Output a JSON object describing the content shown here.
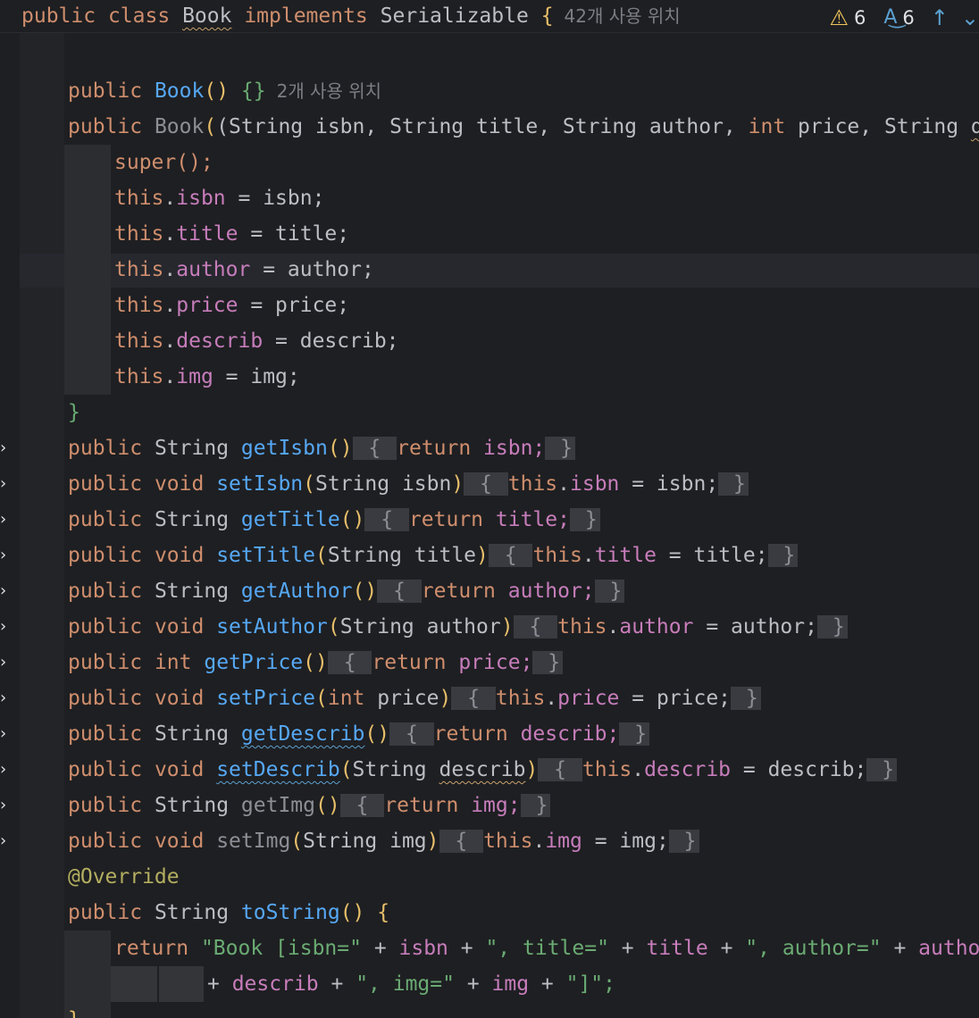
{
  "header": {
    "class_decl": [
      "public",
      "class",
      "Book",
      "implements",
      "Serializable",
      "{"
    ],
    "usage_hint": "42개 사용 위치"
  },
  "status": {
    "warnings": "6",
    "typos": "6"
  },
  "code": {
    "ctor_empty": {
      "kw": "public",
      "name": "Book",
      "parens": "()",
      "body": "{}",
      "hint": "2개 사용 위치"
    },
    "ctor_full": {
      "kw": "public",
      "name": "Book",
      "params": "(String isbn, String title, String author, ",
      "int": "int",
      "params2": " price, String ",
      "last": "describ"
    },
    "super_call": "super();",
    "assignments": [
      {
        "field": "isbn",
        "value": "isbn;"
      },
      {
        "field": "title",
        "value": "title;"
      },
      {
        "field": "author",
        "value": "author;"
      },
      {
        "field": "price",
        "value": "price;"
      },
      {
        "field": "describ",
        "value": "describ;"
      },
      {
        "field": "img",
        "value": "img;"
      }
    ],
    "this_kw": "this",
    "eq": " = ",
    "close_brace": "}",
    "accessors": [
      {
        "type": "String",
        "name": "getIsbn",
        "params": "()",
        "body_kw": "return",
        "body": " isbn;",
        "dim": false
      },
      {
        "type": "void",
        "name": "setIsbn",
        "params": "(String isbn)",
        "body_kw": "this",
        "body_field": "isbn",
        "body": " = isbn;",
        "dim": false
      },
      {
        "type": "String",
        "name": "getTitle",
        "params": "()",
        "body_kw": "return",
        "body": " title;",
        "dim": false
      },
      {
        "type": "void",
        "name": "setTitle",
        "params": "(String title)",
        "body_kw": "this",
        "body_field": "title",
        "body": " = title;",
        "dim": false
      },
      {
        "type": "String",
        "name": "getAuthor",
        "params": "()",
        "body_kw": "return",
        "body": " author;",
        "dim": false
      },
      {
        "type": "void",
        "name": "setAuthor",
        "params": "(String author)",
        "body_kw": "this",
        "body_field": "author",
        "body": " = author;",
        "dim": false
      },
      {
        "type": "int",
        "name": "getPrice",
        "params": "()",
        "body_kw": "return",
        "body": " price;",
        "dim": false
      },
      {
        "type": "void",
        "name": "setPrice",
        "params": "(int price)",
        "body_kw": "this",
        "body_field": "price",
        "body": " = price;",
        "dim": false
      },
      {
        "type": "String",
        "name": "getDescrib",
        "params": "()",
        "body_kw": "return",
        "body": " describ;",
        "dim": false
      },
      {
        "type": "void",
        "name": "setDescrib",
        "params": "(String describ)",
        "body_kw": "this",
        "body_field": "describ",
        "body": " = describ;",
        "dim": false
      },
      {
        "type": "String",
        "name": "getImg",
        "params": "()",
        "body_kw": "return",
        "body": " img;",
        "dim": true
      },
      {
        "type": "void",
        "name": "setImg",
        "params": "(String img)",
        "body_kw": "this",
        "body_field": "img",
        "body": " = img;",
        "dim": true
      }
    ],
    "override": "@Override",
    "tostring_decl": {
      "kw": "public",
      "type": "String",
      "name": "toString",
      "rest": "() {"
    },
    "return_kw": "return",
    "return_line1": {
      "s1": "\"Book [isbn=\"",
      "f1": "isbn",
      "s2": "\", title=\"",
      "f2": "title",
      "s3": "\", author=\"",
      "f3": "author",
      "tail": " + \""
    },
    "return_line2": {
      "f4": "describ",
      "s4": "\", img=\"",
      "f5": "img",
      "s5": "\"]\";"
    },
    "plus": " + "
  }
}
